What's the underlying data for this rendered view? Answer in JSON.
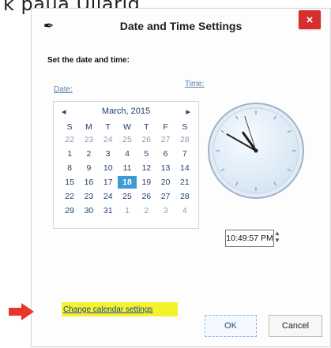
{
  "page": {
    "top_fragment": "k paua Ullarig"
  },
  "window": {
    "title": "Date and Time Settings",
    "close_glyph": "×",
    "app_icon": "pen-quill-icon"
  },
  "content": {
    "heading": "Set the date and time:",
    "date_label": "Date:",
    "time_label": "Time:"
  },
  "calendar": {
    "month_label": "March, 2015",
    "prev_glyph": "◂",
    "next_glyph": "▸",
    "day_headers": [
      "S",
      "M",
      "T",
      "W",
      "T",
      "F",
      "S"
    ],
    "weeks": [
      [
        "22",
        "23",
        "24",
        "25",
        "26",
        "27",
        "28"
      ],
      [
        "1",
        "2",
        "3",
        "4",
        "5",
        "6",
        "7"
      ],
      [
        "8",
        "9",
        "10",
        "11",
        "12",
        "13",
        "14"
      ],
      [
        "15",
        "16",
        "17",
        "18",
        "19",
        "20",
        "21"
      ],
      [
        "22",
        "23",
        "24",
        "25",
        "26",
        "27",
        "28"
      ],
      [
        "29",
        "30",
        "31",
        "1",
        "2",
        "3",
        "4"
      ]
    ],
    "selected_day": "18"
  },
  "clock": {
    "hour": 10,
    "minute": 49,
    "second": 57
  },
  "time": {
    "value": "10:49:57 PM",
    "spin_up": "▲",
    "spin_down": "▼"
  },
  "links": {
    "change_calendar_settings": "Change calendar settings"
  },
  "buttons": {
    "ok": "OK",
    "cancel": "Cancel"
  },
  "colors": {
    "accent_highlight": "#f4f22a",
    "close_button": "#d62d2d",
    "selected_day": "#3c9ad4",
    "annotation_arrow": "#e8372a"
  }
}
